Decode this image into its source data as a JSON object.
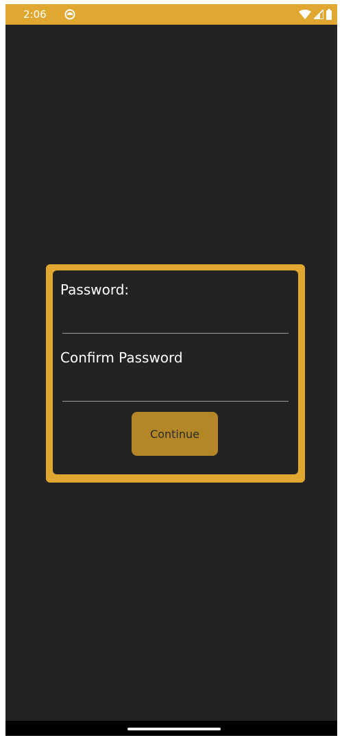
{
  "status_bar": {
    "time": "2:06",
    "background_color": "#E0A830",
    "icons": [
      "notification-icon",
      "wifi-icon",
      "signal-icon",
      "battery-icon"
    ]
  },
  "dialog": {
    "password_label": "Password:",
    "confirm_password_label": "Confirm Password",
    "password_value": "",
    "confirm_password_value": "",
    "continue_label": "Continue",
    "frame_color": "#E0A830",
    "button_color": "#B38727"
  }
}
